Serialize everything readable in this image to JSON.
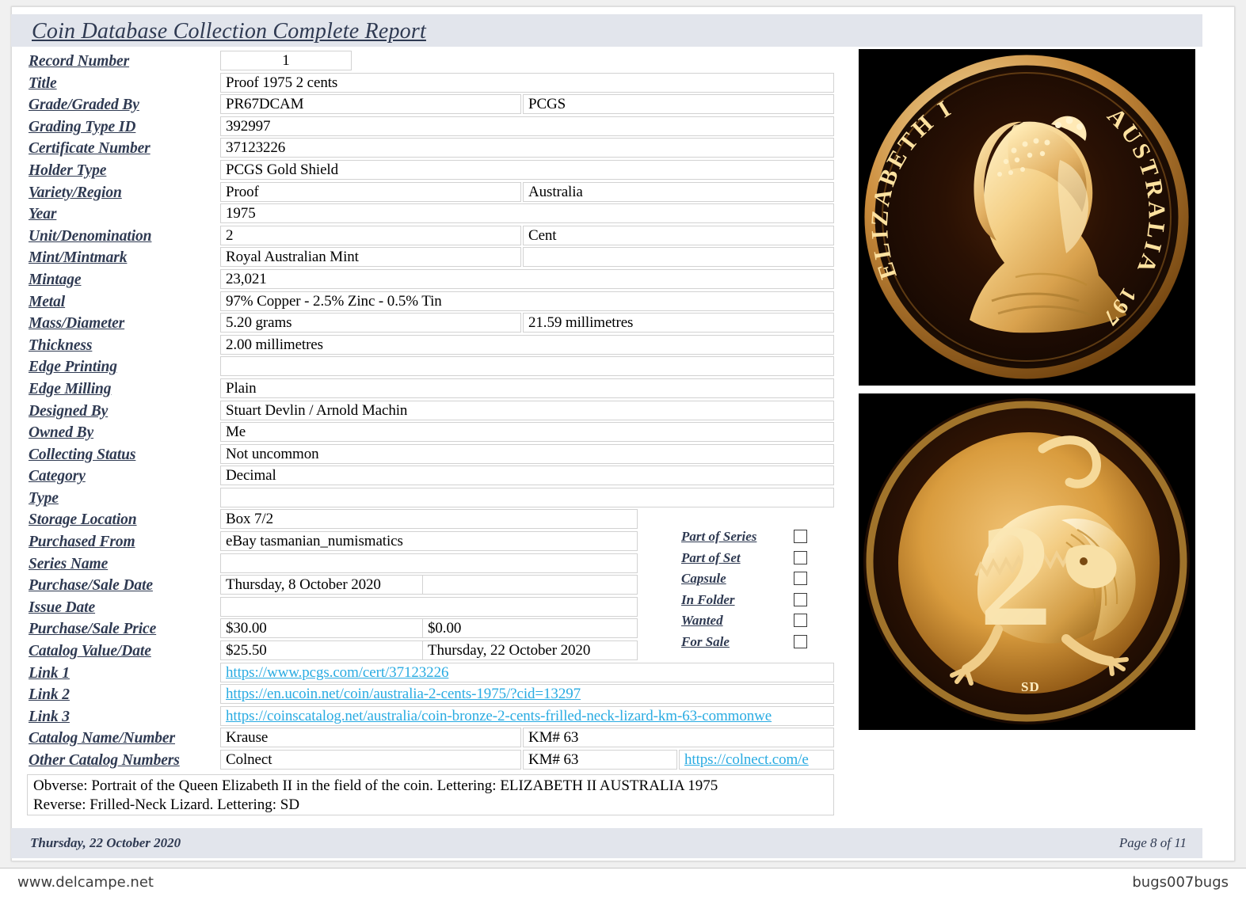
{
  "report": {
    "title": "Coin Database Collection Complete Report"
  },
  "fields": {
    "record_number": {
      "label": "Record Number",
      "value": "1"
    },
    "title": {
      "label": "Title",
      "value": "Proof 1975 2 cents"
    },
    "grade": {
      "label": "Grade/Graded By",
      "value": "PR67DCAM",
      "value2": "PCGS"
    },
    "grading_type_id": {
      "label": "Grading Type ID",
      "value": "392997"
    },
    "certificate_number": {
      "label": "Certificate Number",
      "value": "37123226"
    },
    "holder_type": {
      "label": "Holder Type",
      "value": "PCGS Gold Shield"
    },
    "variety_region": {
      "label": "Variety/Region",
      "value": "Proof",
      "value2": "Australia"
    },
    "year": {
      "label": "Year",
      "value": "1975"
    },
    "unit_denomination": {
      "label": "Unit/Denomination",
      "value": "2",
      "value2": "Cent"
    },
    "mint_mintmark": {
      "label": "Mint/Mintmark",
      "value": "Royal Australian Mint",
      "value2": ""
    },
    "mintage": {
      "label": "Mintage",
      "value": "23,021"
    },
    "metal": {
      "label": "Metal",
      "value": "97% Copper - 2.5% Zinc - 0.5% Tin"
    },
    "mass_diameter": {
      "label": "Mass/Diameter",
      "value": "5.20 grams",
      "value2": "21.59 millimetres"
    },
    "thickness": {
      "label": "Thickness",
      "value": "2.00 millimetres"
    },
    "edge_printing": {
      "label": "Edge Printing",
      "value": ""
    },
    "edge_milling": {
      "label": "Edge Milling",
      "value": "Plain"
    },
    "designed_by": {
      "label": "Designed By",
      "value": "Stuart Devlin / Arnold Machin"
    },
    "owned_by": {
      "label": "Owned By",
      "value": "Me"
    },
    "collecting_status": {
      "label": "Collecting Status",
      "value": "Not uncommon"
    },
    "category": {
      "label": "Category",
      "value": "Decimal"
    },
    "type": {
      "label": "Type",
      "value": ""
    },
    "storage_location": {
      "label": "Storage Location",
      "value": "Box 7/2"
    },
    "purchased_from": {
      "label": "Purchased From",
      "value": "eBay tasmanian_numismatics"
    },
    "series_name": {
      "label": "Series Name",
      "value": ""
    },
    "purchase_sale_date": {
      "label": "Purchase/Sale Date",
      "value": "Thursday, 8 October 2020",
      "value2": ""
    },
    "issue_date": {
      "label": "Issue Date",
      "value": ""
    },
    "purchase_sale_price": {
      "label": "Purchase/Sale Price",
      "value": "$30.00",
      "value2": "$0.00"
    },
    "catalog_value_date": {
      "label": "Catalog Value/Date",
      "value": "$25.50",
      "value2": "Thursday, 22 October 2020"
    },
    "link1": {
      "label": "Link 1",
      "value": "https://www.pcgs.com/cert/37123226"
    },
    "link2": {
      "label": "Link 2",
      "value": "https://en.ucoin.net/coin/australia-2-cents-1975/?cid=13297"
    },
    "link3": {
      "label": "Link 3",
      "value": "https://coinscatalog.net/australia/coin-bronze-2-cents-frilled-neck-lizard-km-63-commonwe"
    },
    "catalog_name_number": {
      "label": "Catalog Name/Number",
      "value": "Krause",
      "value2": "KM# 63"
    },
    "other_catalog_numbers": {
      "label": "Other Catalog Numbers",
      "value": "Colnect",
      "value2": "KM# 63",
      "value3": "https://colnect.com/e"
    }
  },
  "checkboxes": [
    {
      "label": "Part of Series",
      "checked": false
    },
    {
      "label": "Part of Set",
      "checked": false
    },
    {
      "label": "Capsule",
      "checked": false
    },
    {
      "label": "In Folder",
      "checked": false
    },
    {
      "label": "Wanted",
      "checked": false
    },
    {
      "label": "For Sale",
      "checked": false
    }
  ],
  "description": {
    "line1": "Obverse: Portrait of the Queen Elizabeth II in the field of the coin. Lettering: ELIZABETH II AUSTRALIA 1975",
    "line2": "Reverse: Frilled-Neck Lizard. Lettering: SD"
  },
  "coin_images": {
    "obverse": {
      "name": "coin-obverse-elizabeth-ii-1975",
      "legend_left": "ELIZABETH II",
      "legend_right": "AUSTRALIA",
      "date": "1975"
    },
    "reverse": {
      "name": "coin-reverse-frilled-neck-lizard",
      "denomination": "2",
      "designer_initials": "SD"
    }
  },
  "footer": {
    "date": "Thursday, 22 October 2020",
    "page": "Page 8 of 11"
  },
  "watermark": {
    "left": "www.delcampe.net",
    "right": "bugs007bugs"
  },
  "colors": {
    "band": "#e2e5ec",
    "label": "#2f3a52",
    "link": "#29abe2",
    "border": "#d2d2d2"
  }
}
